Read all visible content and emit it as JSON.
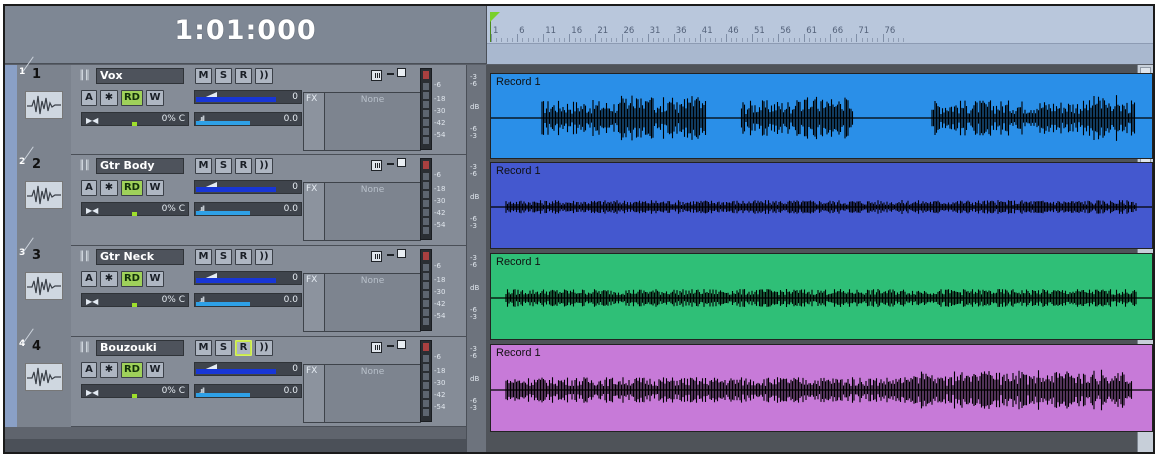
{
  "transport": {
    "time": "1:01:000"
  },
  "ruler": {
    "marks": [
      "1",
      "6",
      "11",
      "16",
      "21",
      "26",
      "31",
      "36",
      "41",
      "46",
      "51",
      "56",
      "61",
      "66",
      "71",
      "76"
    ]
  },
  "fx": {
    "label": "FX",
    "empty_text": "None"
  },
  "meter_scale": [
    "-6",
    "-18",
    "-30",
    "-42",
    "-54"
  ],
  "strip_scale": {
    "top": "-3",
    "top2": "-6",
    "db": "dB",
    "bottom": "-6",
    "bottom2": "-3"
  },
  "tracks": [
    {
      "index": "1",
      "number": "1",
      "name": "Vox",
      "mute": "M",
      "solo": "S",
      "arm": "R",
      "fx_in": "))",
      "auto": "A",
      "freeze": "✱",
      "rec_dual": "RD",
      "write": "W",
      "volume_value": "0",
      "pan_value": "0% C",
      "width_value": "0.0",
      "item_label": "Record 1",
      "color": "#2a8fe8",
      "armed": false
    },
    {
      "index": "2",
      "number": "2",
      "name": "Gtr Body",
      "mute": "M",
      "solo": "S",
      "arm": "R",
      "fx_in": "))",
      "auto": "A",
      "freeze": "✱",
      "rec_dual": "RD",
      "write": "W",
      "volume_value": "0",
      "pan_value": "0% C",
      "width_value": "0.0",
      "item_label": "Record 1",
      "color": "#4458cf",
      "armed": false
    },
    {
      "index": "3",
      "number": "3",
      "name": "Gtr Neck",
      "mute": "M",
      "solo": "S",
      "arm": "R",
      "fx_in": "))",
      "auto": "A",
      "freeze": "✱",
      "rec_dual": "RD",
      "write": "W",
      "volume_value": "0",
      "pan_value": "0% C",
      "width_value": "0.0",
      "item_label": "Record 1",
      "color": "#2fbf77",
      "armed": false
    },
    {
      "index": "4",
      "number": "4",
      "name": "Bouzouki",
      "mute": "M",
      "solo": "S",
      "arm": "R",
      "fx_in": "))",
      "auto": "A",
      "freeze": "✱",
      "rec_dual": "RD",
      "write": "W",
      "volume_value": "0",
      "pan_value": "0% C",
      "width_value": "0.0",
      "item_label": "Record 1",
      "color": "#c77ad8",
      "armed": true
    }
  ]
}
